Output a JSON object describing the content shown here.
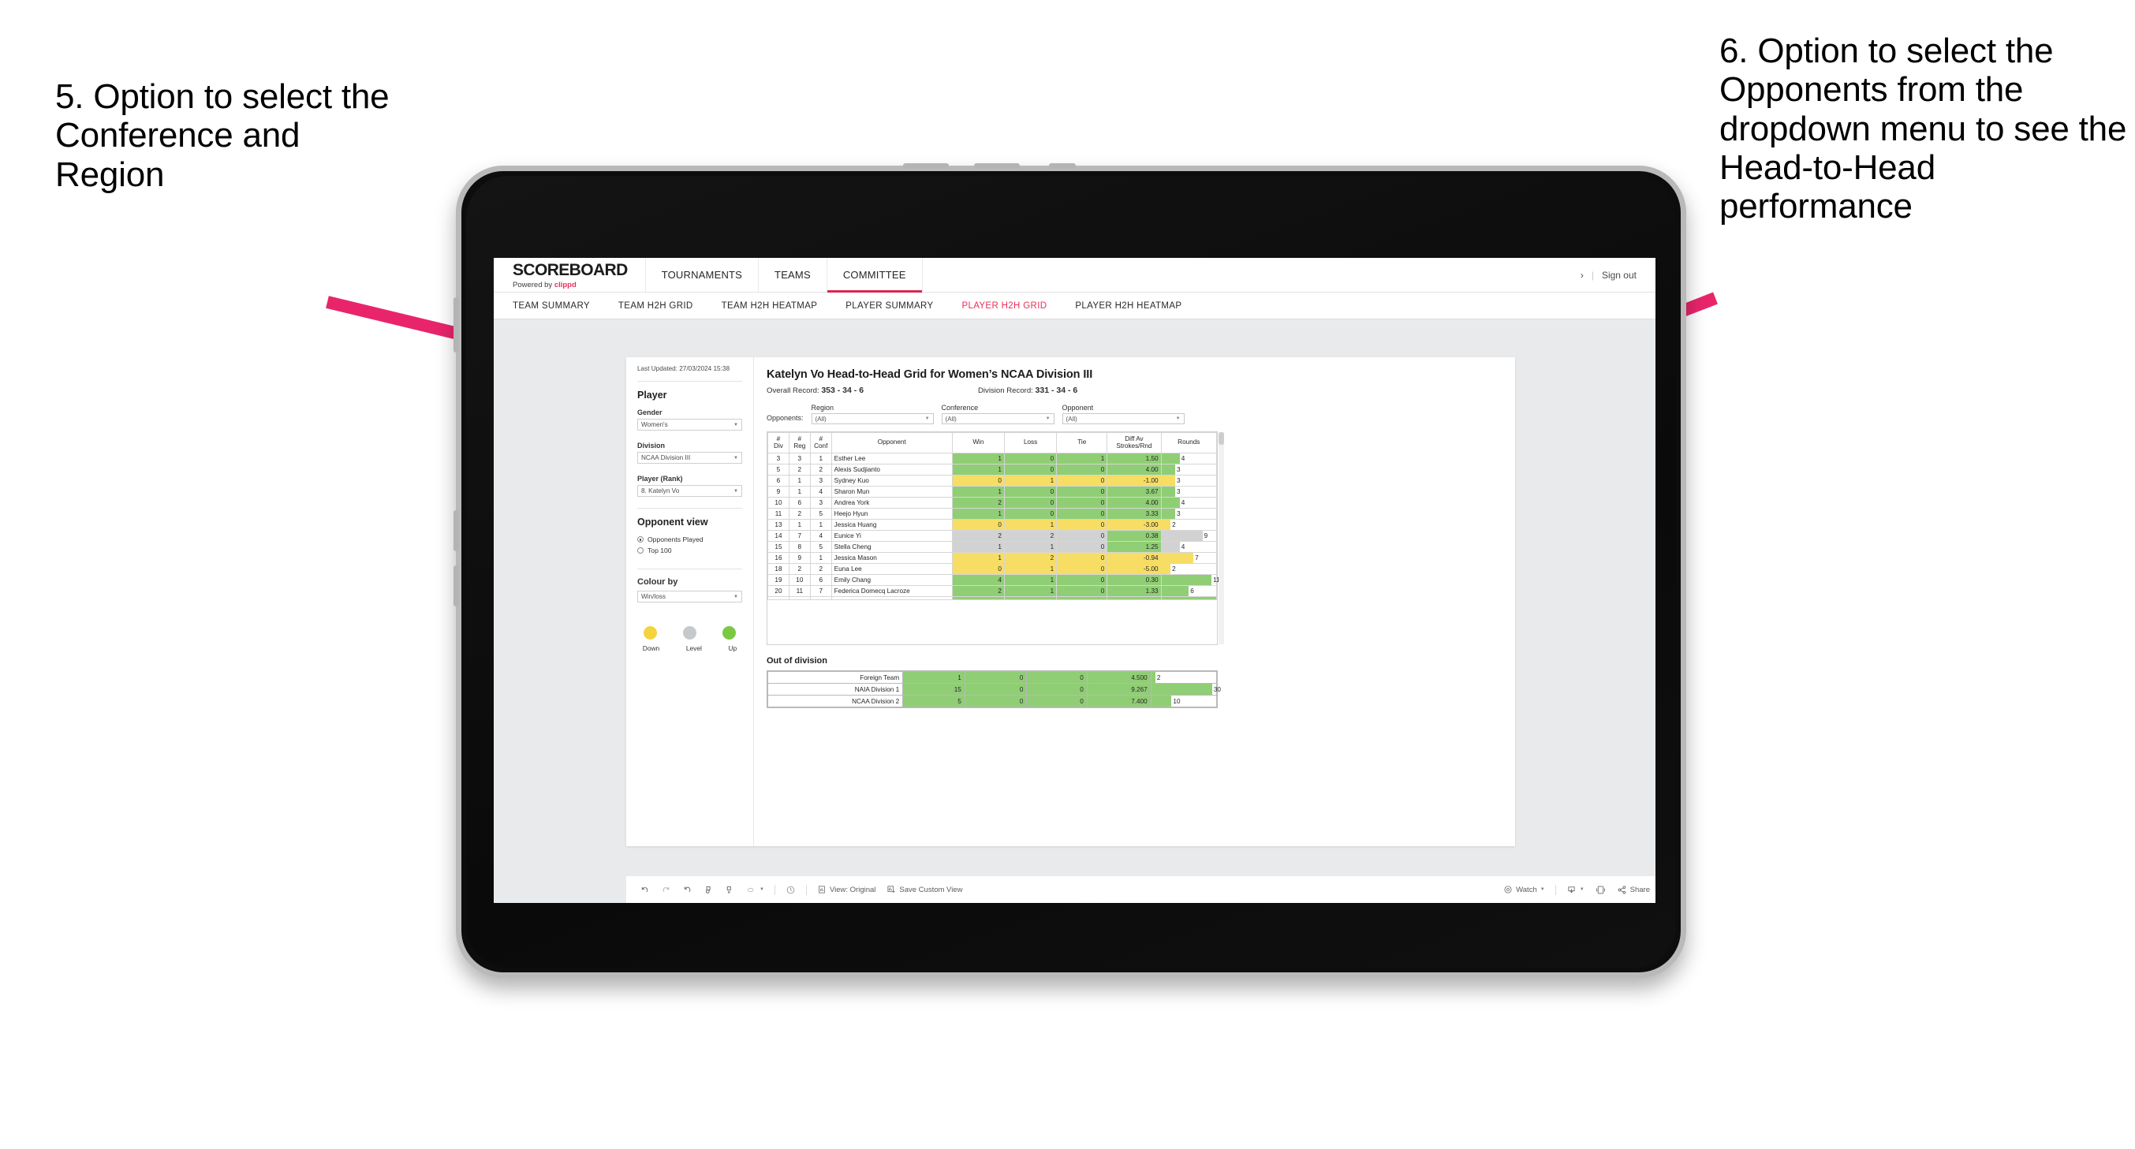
{
  "annotations": [
    {
      "id": "annot-5",
      "text": "5. Option to select the Conference and Region"
    },
    {
      "id": "annot-6",
      "text": "6. Option to select the Opponents from the dropdown menu to see the Head-to-Head performance"
    }
  ],
  "arrow_color": "#e8256b",
  "app": {
    "brand": {
      "name": "SCOREBOARD",
      "powered_prefix": "Powered by ",
      "powered_by": "clippd"
    },
    "topnav": [
      {
        "label": "TOURNAMENTS",
        "active": false
      },
      {
        "label": "TEAMS",
        "active": false
      },
      {
        "label": "COMMITTEE",
        "active": true
      }
    ],
    "topnav_right": {
      "chevron": "›",
      "separator": "|",
      "sign_out": "Sign out"
    },
    "subnav": [
      {
        "label": "TEAM SUMMARY",
        "active": false
      },
      {
        "label": "TEAM H2H GRID",
        "active": false
      },
      {
        "label": "TEAM H2H HEATMAP",
        "active": false
      },
      {
        "label": "PLAYER SUMMARY",
        "active": false
      },
      {
        "label": "PLAYER H2H GRID",
        "active": true
      },
      {
        "label": "PLAYER H2H HEATMAP",
        "active": false
      }
    ]
  },
  "panel": {
    "last_updated": "Last Updated: 27/03/2024 15:38",
    "section_player": "Player",
    "gender": {
      "label": "Gender",
      "value": "Women's"
    },
    "division": {
      "label": "Division",
      "value": "NCAA Division III"
    },
    "player_rank": {
      "label": "Player (Rank)",
      "value": "8. Katelyn Vo"
    },
    "opponent_view": {
      "title": "Opponent view",
      "options": [
        {
          "label": "Opponents Played",
          "selected": true
        },
        {
          "label": "Top 100",
          "selected": false
        }
      ]
    },
    "colour_by": {
      "label": "Colour by",
      "value": "Win/loss"
    },
    "legend": [
      {
        "label": "Down",
        "color": "#f3d43f"
      },
      {
        "label": "Level",
        "color": "#c6c9cc"
      },
      {
        "label": "Up",
        "color": "#7ac943"
      }
    ]
  },
  "view": {
    "title": "Katelyn Vo Head-to-Head Grid for Women’s NCAA Division III",
    "overall_record_label": "Overall Record:",
    "overall_record_value": "353 - 34 - 6",
    "division_record_label": "Division Record:",
    "division_record_value": "331 - 34 - 6",
    "opponents_label": "Opponents:",
    "filters": [
      {
        "name": "region",
        "label": "Region",
        "value": "(All)"
      },
      {
        "name": "conference",
        "label": "Conference",
        "value": "(All)"
      },
      {
        "name": "opponent",
        "label": "Opponent",
        "value": "(All)"
      }
    ]
  },
  "grid": {
    "headers": [
      {
        "line1": "#",
        "line2": "Div"
      },
      {
        "line1": "#",
        "line2": "Reg"
      },
      {
        "line1": "#",
        "line2": "Conf"
      },
      {
        "line1": "Opponent",
        "line2": ""
      },
      {
        "line1": "Win",
        "line2": ""
      },
      {
        "line1": "Loss",
        "line2": ""
      },
      {
        "line1": "Tie",
        "line2": ""
      },
      {
        "line1": "Diff Av",
        "line2": "Strokes/Rnd"
      },
      {
        "line1": "Rounds",
        "line2": ""
      }
    ],
    "rows": [
      {
        "div": "3",
        "reg": "3",
        "conf": "1",
        "opponent": "Esther Lee",
        "win": "1",
        "loss": "0",
        "tie": "1",
        "diff": "1.50",
        "rounds": 4,
        "color": "green"
      },
      {
        "div": "5",
        "reg": "2",
        "conf": "2",
        "opponent": "Alexis Sudjianto",
        "win": "1",
        "loss": "0",
        "tie": "0",
        "diff": "4.00",
        "rounds": 3,
        "color": "green"
      },
      {
        "div": "6",
        "reg": "1",
        "conf": "3",
        "opponent": "Sydney Kuo",
        "win": "0",
        "loss": "1",
        "tie": "0",
        "diff": "-1.00",
        "rounds": 3,
        "color": "yellow"
      },
      {
        "div": "9",
        "reg": "1",
        "conf": "4",
        "opponent": "Sharon Mun",
        "win": "1",
        "loss": "0",
        "tie": "0",
        "diff": "3.67",
        "rounds": 3,
        "color": "green"
      },
      {
        "div": "10",
        "reg": "6",
        "conf": "3",
        "opponent": "Andrea York",
        "win": "2",
        "loss": "0",
        "tie": "0",
        "diff": "4.00",
        "rounds": 4,
        "color": "green"
      },
      {
        "div": "11",
        "reg": "2",
        "conf": "5",
        "opponent": "Heejo Hyun",
        "win": "1",
        "loss": "0",
        "tie": "0",
        "diff": "3.33",
        "rounds": 3,
        "color": "green"
      },
      {
        "div": "13",
        "reg": "1",
        "conf": "1",
        "opponent": "Jessica Huang",
        "win": "0",
        "loss": "1",
        "tie": "0",
        "diff": "-3.00",
        "rounds": 2,
        "color": "yellow"
      },
      {
        "div": "14",
        "reg": "7",
        "conf": "4",
        "opponent": "Eunice Yi",
        "win": "2",
        "loss": "2",
        "tie": "0",
        "diff": "0.38",
        "rounds": 9,
        "color": "grey",
        "diff_color": "green"
      },
      {
        "div": "15",
        "reg": "8",
        "conf": "5",
        "opponent": "Stella Cheng",
        "win": "1",
        "loss": "1",
        "tie": "0",
        "diff": "1.25",
        "rounds": 4,
        "color": "grey",
        "diff_color": "green"
      },
      {
        "div": "16",
        "reg": "9",
        "conf": "1",
        "opponent": "Jessica Mason",
        "win": "1",
        "loss": "2",
        "tie": "0",
        "diff": "-0.94",
        "rounds": 7,
        "color": "yellow"
      },
      {
        "div": "18",
        "reg": "2",
        "conf": "2",
        "opponent": "Euna Lee",
        "win": "0",
        "loss": "1",
        "tie": "0",
        "diff": "-5.00",
        "rounds": 2,
        "color": "yellow"
      },
      {
        "div": "19",
        "reg": "10",
        "conf": "6",
        "opponent": "Emily Chang",
        "win": "4",
        "loss": "1",
        "tie": "0",
        "diff": "0.30",
        "rounds": 11,
        "color": "green"
      },
      {
        "div": "20",
        "reg": "11",
        "conf": "7",
        "opponent": "Federica Domecq Lacroze",
        "win": "2",
        "loss": "1",
        "tie": "0",
        "diff": "1.33",
        "rounds": 6,
        "color": "green"
      }
    ],
    "rounds_max": 12
  },
  "out_of_division": {
    "title": "Out of division",
    "rows": [
      {
        "name": "Foreign Team",
        "win": "1",
        "loss": "0",
        "tie": "0",
        "diff": "4.500",
        "rounds": 2,
        "color": "green"
      },
      {
        "name": "NAIA Division 1",
        "win": "15",
        "loss": "0",
        "tie": "0",
        "diff": "9.267",
        "rounds": 30,
        "color": "green"
      },
      {
        "name": "NCAA Division 2",
        "win": "5",
        "loss": "0",
        "tie": "0",
        "diff": "7.400",
        "rounds": 10,
        "color": "green"
      }
    ],
    "rounds_max": 32
  },
  "toolbar": {
    "view_original": "View: Original",
    "save_custom_view": "Save Custom View",
    "watch": "Watch",
    "share": "Share",
    "caret": "▾"
  },
  "colors": {
    "green": "#90ce75",
    "yellow": "#f7dd63",
    "grey": "#d2d2d2",
    "accent": "#e8305a",
    "brand_pink": "#e8305a"
  }
}
